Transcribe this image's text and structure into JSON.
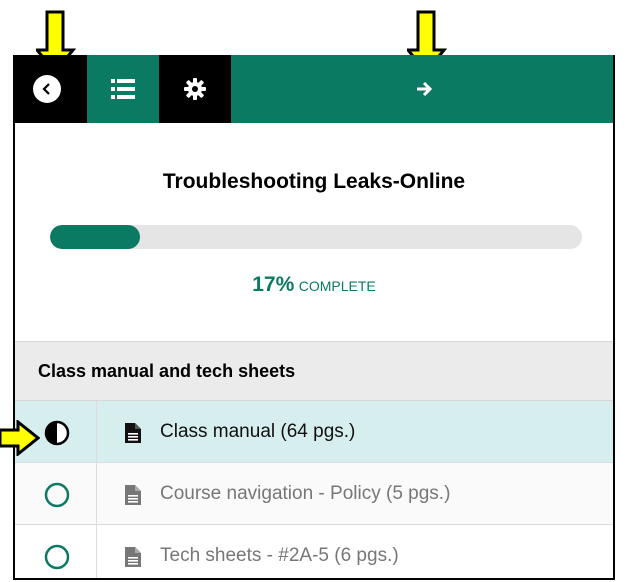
{
  "topbar": {
    "back_icon": "chevron-left-icon",
    "list_icon": "list-icon",
    "settings_icon": "gear-icon",
    "next_icon": "arrow-right-icon"
  },
  "course": {
    "title": "Troubleshooting Leaks-Online",
    "progress_percent": 17,
    "progress_label": "17%",
    "progress_suffix": "COMPLETE"
  },
  "section": {
    "title": "Class manual and tech sheets",
    "items": [
      {
        "label": "Class manual (64 pgs.)",
        "status": "in-progress",
        "active": true
      },
      {
        "label": "Course navigation - Policy (5 pgs.)",
        "status": "not-started",
        "active": false
      },
      {
        "label": "Tech sheets - #2A-5 (6 pgs.)",
        "status": "not-started",
        "active": false
      }
    ]
  },
  "colors": {
    "accent": "#0b7a63",
    "highlight_row": "#d6eeee",
    "annotation_yellow": "#ffff00"
  }
}
